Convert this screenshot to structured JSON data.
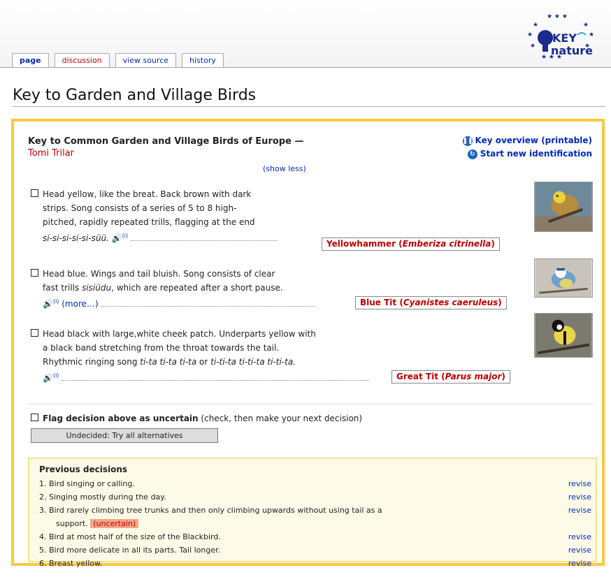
{
  "tabs": [
    {
      "label": "page"
    },
    {
      "label": "discussion"
    },
    {
      "label": "view source"
    },
    {
      "label": "history"
    }
  ],
  "logo": {
    "line1": "KEY",
    "line2": "nature"
  },
  "page_title": "Key to Garden and Village Birds",
  "key": {
    "title": "Key to Common Garden and Village Birds of Europe",
    "dash": "—",
    "author": "Tomi Trilar",
    "show_less": "(show less)",
    "overview_link": "Key overview (printable)",
    "new_identification_link": "Start new identification"
  },
  "choices": [
    {
      "text1": "Head yellow, like the breat. Back brown with dark",
      "text2": "strips. Song consists of a series of 5 to 8 high-",
      "text3": "pitched, rapidly repeated trills, flagging at the end",
      "song": "si-si-si-si-si-süü.",
      "info": "(i)",
      "result_common": "Yellowhammer",
      "result_latin": "Emberiza citrinella"
    },
    {
      "text1": "Head blue. Wings and tail bluish. Song consists of clear",
      "text2a": "fast trills",
      "song": "sisiüdu",
      "text2b": ", which are repeated after a short pause.",
      "info": "(i)",
      "more": "(more…)",
      "result_common": "Blue Tit",
      "result_latin": "Cyanistes caeruleus"
    },
    {
      "text1": "Head black with large,white cheek patch. Underparts yellow with",
      "text2": "a black band stretching from the throat towards the tail.",
      "text3a": "Rhythmic ringing song",
      "song1": "ti-ta ti-ta ti-ta",
      "or": "or",
      "song2": "ti-ti-ta ti-ti-ta ti-ti-ta.",
      "info": "(i)",
      "result_common": "Great Tit",
      "result_latin": "Parus major"
    }
  ],
  "flag": {
    "label_bold": "Flag decision above as uncertain",
    "label_rest": "(check, then make your next decision)"
  },
  "undecided_button": "Undecided: Try all alternatives",
  "previous": {
    "heading": "Previous decisions",
    "items": [
      {
        "text": "1. Bird singing or calling.",
        "revise": "revise"
      },
      {
        "text": "2. Singing mostly during the day.",
        "revise": "revise"
      },
      {
        "text": "3. Bird rarely climbing tree trunks and then only climbing upwards without using tail as a",
        "text_cont": "support.",
        "tag": "(uncertain)",
        "revise": "revise"
      },
      {
        "text": "4. Bird at most half of the size of the Blackbird.",
        "revise": "revise"
      },
      {
        "text": "5. Bird more delicate in all its parts. Tail longer.",
        "revise": "revise"
      },
      {
        "text": "6. Breast yellow.",
        "revise": "revise"
      }
    ]
  },
  "colors": {
    "accent_border": "#f9c93e",
    "link": "#002bb8",
    "result_red": "#ba0000"
  }
}
